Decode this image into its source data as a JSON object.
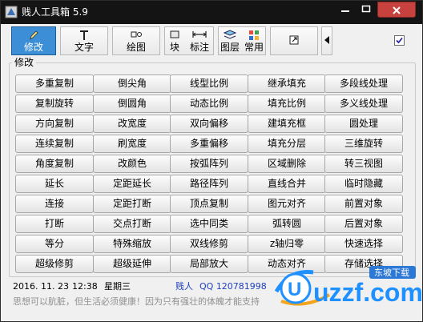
{
  "window": {
    "title": "贱人工具箱 5.9"
  },
  "toolbar": {
    "modify_label": "修改",
    "text_label": "文字",
    "draw_label": "绘图",
    "block_label": "块",
    "dim_label": "标注",
    "layer_label": "图层",
    "common_label": "常用",
    "checkbox_checked": true
  },
  "group": {
    "title": "修改"
  },
  "commands": [
    "多重复制",
    "倒尖角",
    "线型比例",
    "继承填充",
    "多段线处理",
    "复制旋转",
    "倒圆角",
    "动态比例",
    "填充比例",
    "多义线处理",
    "方向复制",
    "改宽度",
    "双向偏移",
    "建填充框",
    "圆处理",
    "连续复制",
    "刷宽度",
    "多重偏移",
    "填充分层",
    "三维旋转",
    "角度复制",
    "改颜色",
    "按弧阵列",
    "区域删除",
    "转三视图",
    "延长",
    "定距延长",
    "路径阵列",
    "直线合并",
    "临时隐藏",
    "连接",
    "定距打断",
    "顶点复制",
    "图元对齐",
    "前置对象",
    "打断",
    "交点打断",
    "选中同类",
    "弧转圆",
    "后置对象",
    "等分",
    "特殊缩放",
    "双线修剪",
    "z轴归零",
    "快速选择",
    "超级修剪",
    "超级延伸",
    "局部放大",
    "动态对齐",
    "存储选择"
  ],
  "status": {
    "date": "2016. 11. 23",
    "time": "12:38",
    "weekday": "星期三",
    "author": "贱人",
    "qq": "QQ 120781998",
    "motto": "思想可以肮脏，但生活必须健康！因为只有强壮的体魄才能支持"
  },
  "watermark": {
    "text": "uzzf.com",
    "badge": "东坡下载"
  },
  "colors": {
    "titlebar": "#141414",
    "active": "#3c8fd6",
    "close": "#c7423e",
    "author": "#1e3fbf"
  }
}
